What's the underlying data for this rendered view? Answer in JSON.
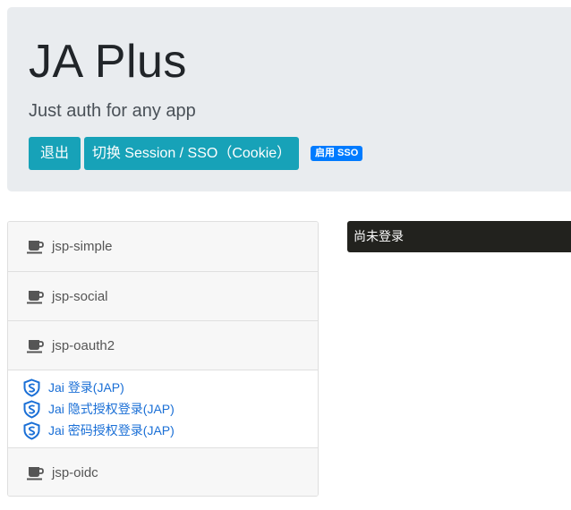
{
  "header": {
    "title": "JA Plus",
    "tagline": "Just auth for any app",
    "logout_label": "退出",
    "switch_label": "切换 Session / SSO（Cookie）",
    "sso_badge": "启用 SSO"
  },
  "sidebar": {
    "items": [
      {
        "label": "jsp-simple",
        "icon": "coffee-cup-icon"
      },
      {
        "label": "jsp-social",
        "icon": "coffee-cup-icon"
      },
      {
        "label": "jsp-oauth2",
        "icon": "coffee-cup-icon"
      },
      {
        "label": "jsp-oidc",
        "icon": "coffee-cup-icon"
      }
    ],
    "oauth2_links": [
      {
        "label": "Jai 登录(JAP)",
        "icon": "shield-icon"
      },
      {
        "label": "Jai 隐式授权登录(JAP)",
        "icon": "shield-icon"
      },
      {
        "label": "Jai 密码授权登录(JAP)",
        "icon": "shield-icon"
      }
    ]
  },
  "status": {
    "text": "尚未登录"
  },
  "colors": {
    "accent": "#17a2b8",
    "badge": "#007bff",
    "link": "#1a6fd6",
    "status_bg": "#22221e",
    "jumbotron_bg": "#e9ecef"
  }
}
